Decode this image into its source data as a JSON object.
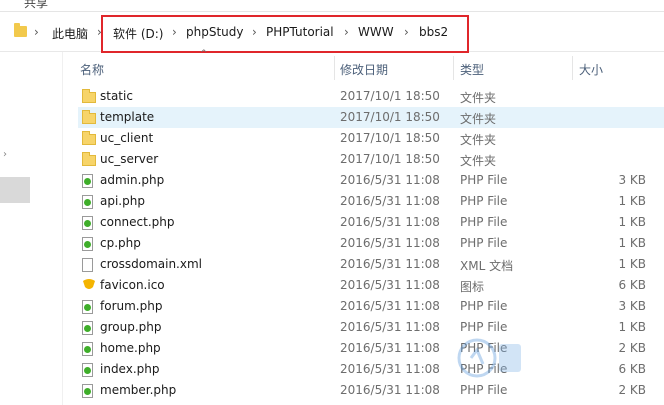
{
  "ribbon": {
    "share_tab": "共享"
  },
  "address": {
    "root": "此电脑",
    "crumbs": [
      "软件 (D:)",
      "phpStudy",
      "PHPTutorial",
      "WWW",
      "bbs2"
    ],
    "separator": "›"
  },
  "columns": {
    "name": "名称",
    "date": "修改日期",
    "type": "类型",
    "size": "大小"
  },
  "files": [
    {
      "name": "static",
      "date": "2017/10/1 18:50",
      "type": "文件夹",
      "size": "",
      "icon": "folder-icon"
    },
    {
      "name": "template",
      "date": "2017/10/1 18:50",
      "type": "文件夹",
      "size": "",
      "icon": "folder-icon",
      "selected": true
    },
    {
      "name": "uc_client",
      "date": "2017/10/1 18:50",
      "type": "文件夹",
      "size": "",
      "icon": "folder-icon"
    },
    {
      "name": "uc_server",
      "date": "2017/10/1 18:50",
      "type": "文件夹",
      "size": "",
      "icon": "folder-icon"
    },
    {
      "name": "admin.php",
      "date": "2016/5/31 11:08",
      "type": "PHP File",
      "size": "3 KB",
      "icon": "php-file-icon"
    },
    {
      "name": "api.php",
      "date": "2016/5/31 11:08",
      "type": "PHP File",
      "size": "1 KB",
      "icon": "php-file-icon"
    },
    {
      "name": "connect.php",
      "date": "2016/5/31 11:08",
      "type": "PHP File",
      "size": "1 KB",
      "icon": "php-file-icon"
    },
    {
      "name": "cp.php",
      "date": "2016/5/31 11:08",
      "type": "PHP File",
      "size": "1 KB",
      "icon": "php-file-icon"
    },
    {
      "name": "crossdomain.xml",
      "date": "2016/5/31 11:08",
      "type": "XML 文档",
      "size": "1 KB",
      "icon": "xml-file-icon"
    },
    {
      "name": "favicon.ico",
      "date": "2016/5/31 11:08",
      "type": "图标",
      "size": "6 KB",
      "icon": "ico-file-icon"
    },
    {
      "name": "forum.php",
      "date": "2016/5/31 11:08",
      "type": "PHP File",
      "size": "3 KB",
      "icon": "php-file-icon"
    },
    {
      "name": "group.php",
      "date": "2016/5/31 11:08",
      "type": "PHP File",
      "size": "1 KB",
      "icon": "php-file-icon"
    },
    {
      "name": "home.php",
      "date": "2016/5/31 11:08",
      "type": "PHP File",
      "size": "2 KB",
      "icon": "php-file-icon"
    },
    {
      "name": "index.php",
      "date": "2016/5/31 11:08",
      "type": "PHP File",
      "size": "6 KB",
      "icon": "php-file-icon"
    },
    {
      "name": "member.php",
      "date": "2016/5/31 11:08",
      "type": "PHP File",
      "size": "2 KB",
      "icon": "php-file-icon"
    }
  ],
  "colors": {
    "highlight_box": "#e0262b",
    "selected_row": "#e5f3fb",
    "header_text": "#4c607a"
  }
}
